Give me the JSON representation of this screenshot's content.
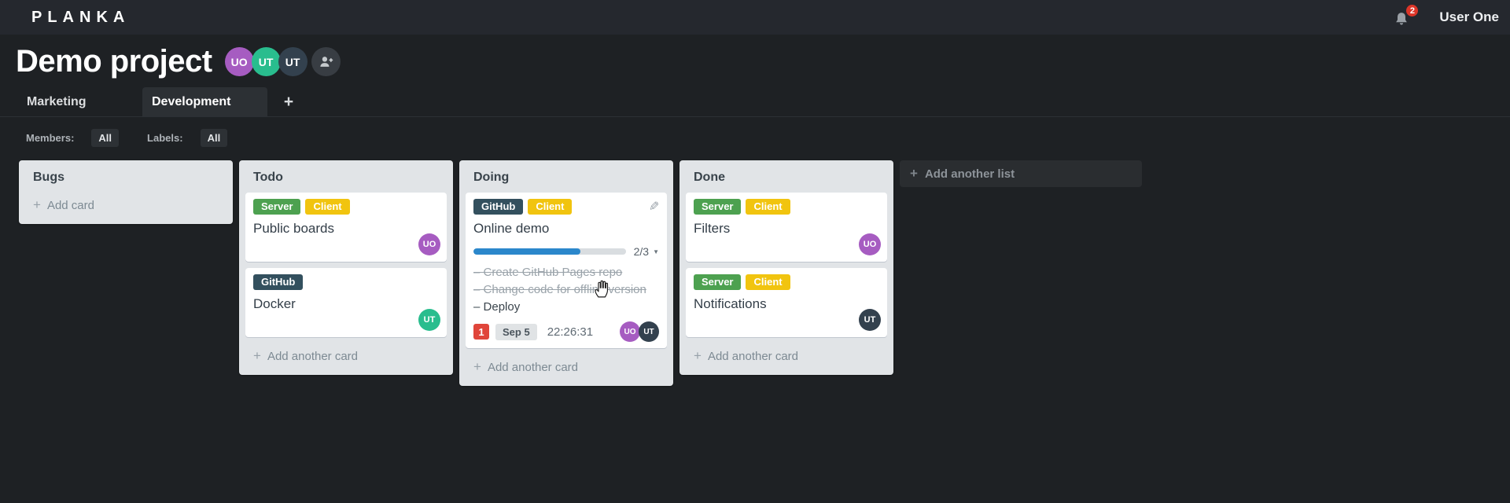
{
  "header": {
    "logo": "PLANKA",
    "notification_count": "2",
    "user_name": "User One"
  },
  "project": {
    "title": "Demo project",
    "members": [
      {
        "initials": "UO",
        "color": "#a65cc1"
      },
      {
        "initials": "UT",
        "color": "#29bd8e"
      },
      {
        "initials": "UT",
        "color": "#33414e"
      }
    ]
  },
  "tabs": {
    "items": [
      {
        "label": "Marketing"
      },
      {
        "label": "Development"
      }
    ],
    "add_label": "+"
  },
  "filters": {
    "members_label": "Members:",
    "members_value": "All",
    "labels_label": "Labels:",
    "labels_value": "All"
  },
  "icons": {
    "edit": "✎",
    "caret_down": "▼",
    "plus": "+"
  },
  "board": {
    "add_list_label": "Add another list",
    "lists": [
      {
        "title": "Bugs",
        "add_card_label": "Add card",
        "cards": []
      },
      {
        "title": "Todo",
        "add_card_label": "Add another card",
        "cards": [
          {
            "title": "Public boards",
            "labels": [
              {
                "text": "Server",
                "color": "#4da150"
              },
              {
                "text": "Client",
                "color": "#f1c40f"
              }
            ],
            "member": {
              "initials": "UO",
              "color": "#a65cc1"
            }
          },
          {
            "title": "Docker",
            "labels": [
              {
                "text": "GitHub",
                "color": "#33505e"
              }
            ],
            "member": {
              "initials": "UT",
              "color": "#29bd8e"
            }
          }
        ]
      },
      {
        "title": "Doing",
        "add_card_label": "Add another card",
        "cards": [
          {
            "title": "Online demo",
            "labels": [
              {
                "text": "GitHub",
                "color": "#33505e"
              },
              {
                "text": "Client",
                "color": "#f1c40f"
              }
            ],
            "progress": {
              "label": "2/3",
              "percent": 70
            },
            "tasks": [
              {
                "text": "Create GitHub Pages repo",
                "done": true
              },
              {
                "text": "Change code for offline version",
                "done": true
              },
              {
                "text": "Deploy",
                "done": false
              }
            ],
            "notification_count": "1",
            "due_date": "Sep 5",
            "timer": "22:26:31",
            "members": [
              {
                "initials": "UO",
                "color": "#a65cc1"
              },
              {
                "initials": "UT",
                "color": "#33414e"
              }
            ]
          }
        ]
      },
      {
        "title": "Done",
        "add_card_label": "Add another card",
        "cards": [
          {
            "title": "Filters",
            "labels": [
              {
                "text": "Server",
                "color": "#4da150"
              },
              {
                "text": "Client",
                "color": "#f1c40f"
              }
            ],
            "member": {
              "initials": "UO",
              "color": "#a65cc1"
            }
          },
          {
            "title": "Notifications",
            "labels": [
              {
                "text": "Server",
                "color": "#4da150"
              },
              {
                "text": "Client",
                "color": "#f1c40f"
              }
            ],
            "member": {
              "initials": "UT",
              "color": "#33414e"
            }
          }
        ]
      }
    ]
  }
}
